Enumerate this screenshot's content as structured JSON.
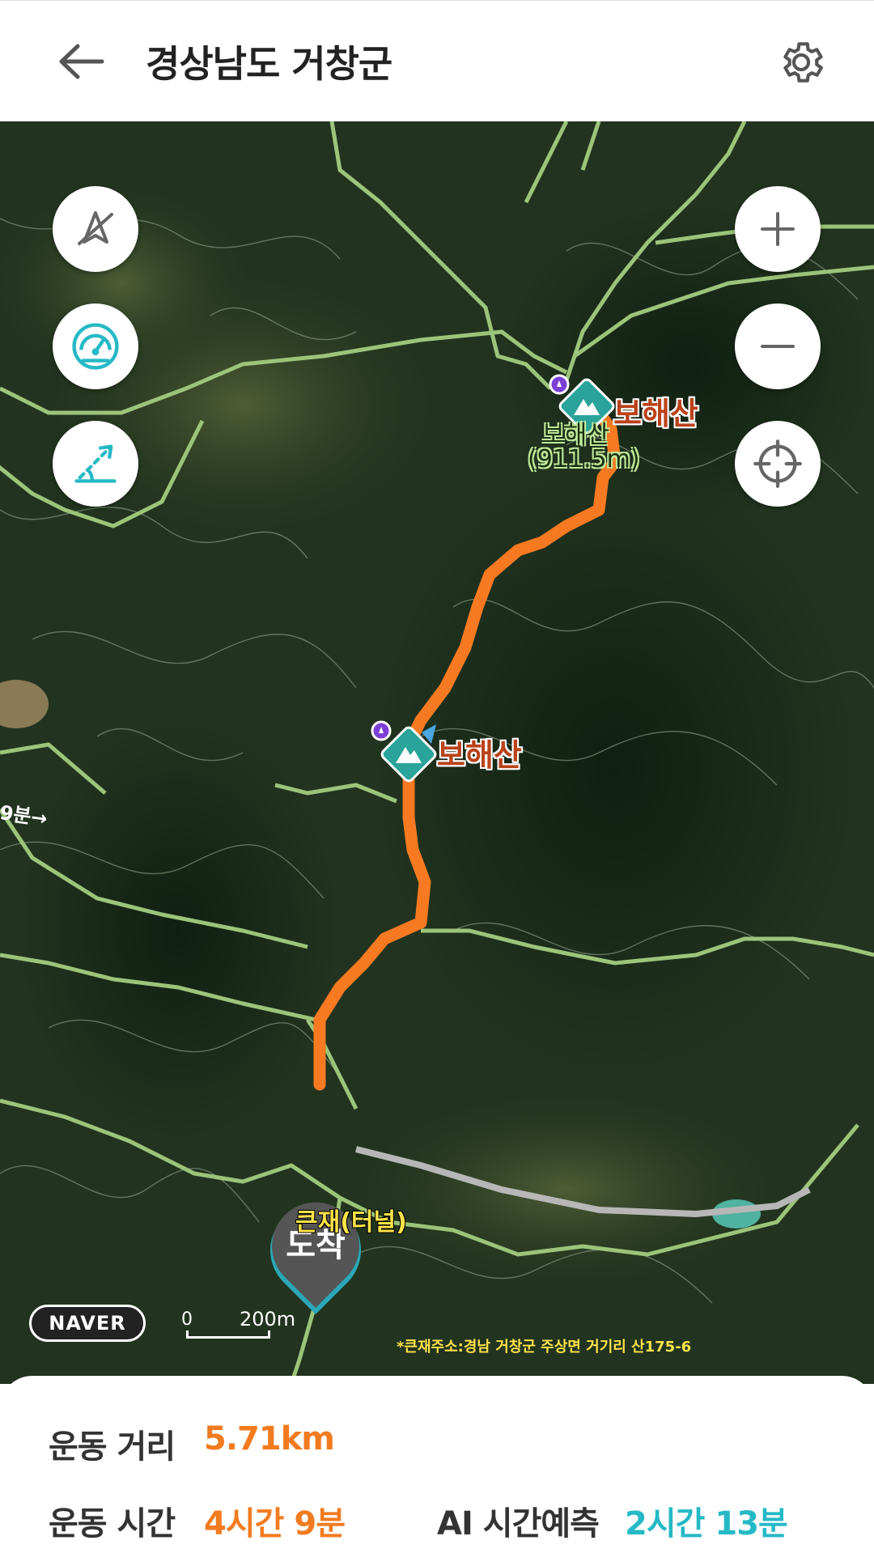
{
  "header": {
    "title": "경상남도 거창군",
    "back_icon": "arrow-left-icon",
    "settings_icon": "gear-icon"
  },
  "map": {
    "peaks": [
      {
        "name": "보해산",
        "elevation_label": "보해산",
        "elevation": "(911.5m)"
      },
      {
        "name": "보해산"
      }
    ],
    "arrive_label": "도착",
    "tunnel_label": "큰재(터널)",
    "address_note": "*큰재주소:경남 거창군 주상면 거기리 산175-6",
    "time_hint": "9분→",
    "logo": "NAVER",
    "scale_zero": "0",
    "scale_distance": "200m",
    "controls_left": [
      "compass-off-icon",
      "speedometer-icon",
      "slope-icon"
    ],
    "controls_right": [
      "zoom-in-icon",
      "zoom-out-icon",
      "locate-icon"
    ],
    "route_color": "#f77a22"
  },
  "stats": {
    "distance_label": "운동 거리",
    "distance_value": "5.71km",
    "time_label": "운동 시간",
    "time_value": "4시간 9분",
    "ai_label": "AI 시간예측",
    "ai_value": "2시간 13분"
  }
}
